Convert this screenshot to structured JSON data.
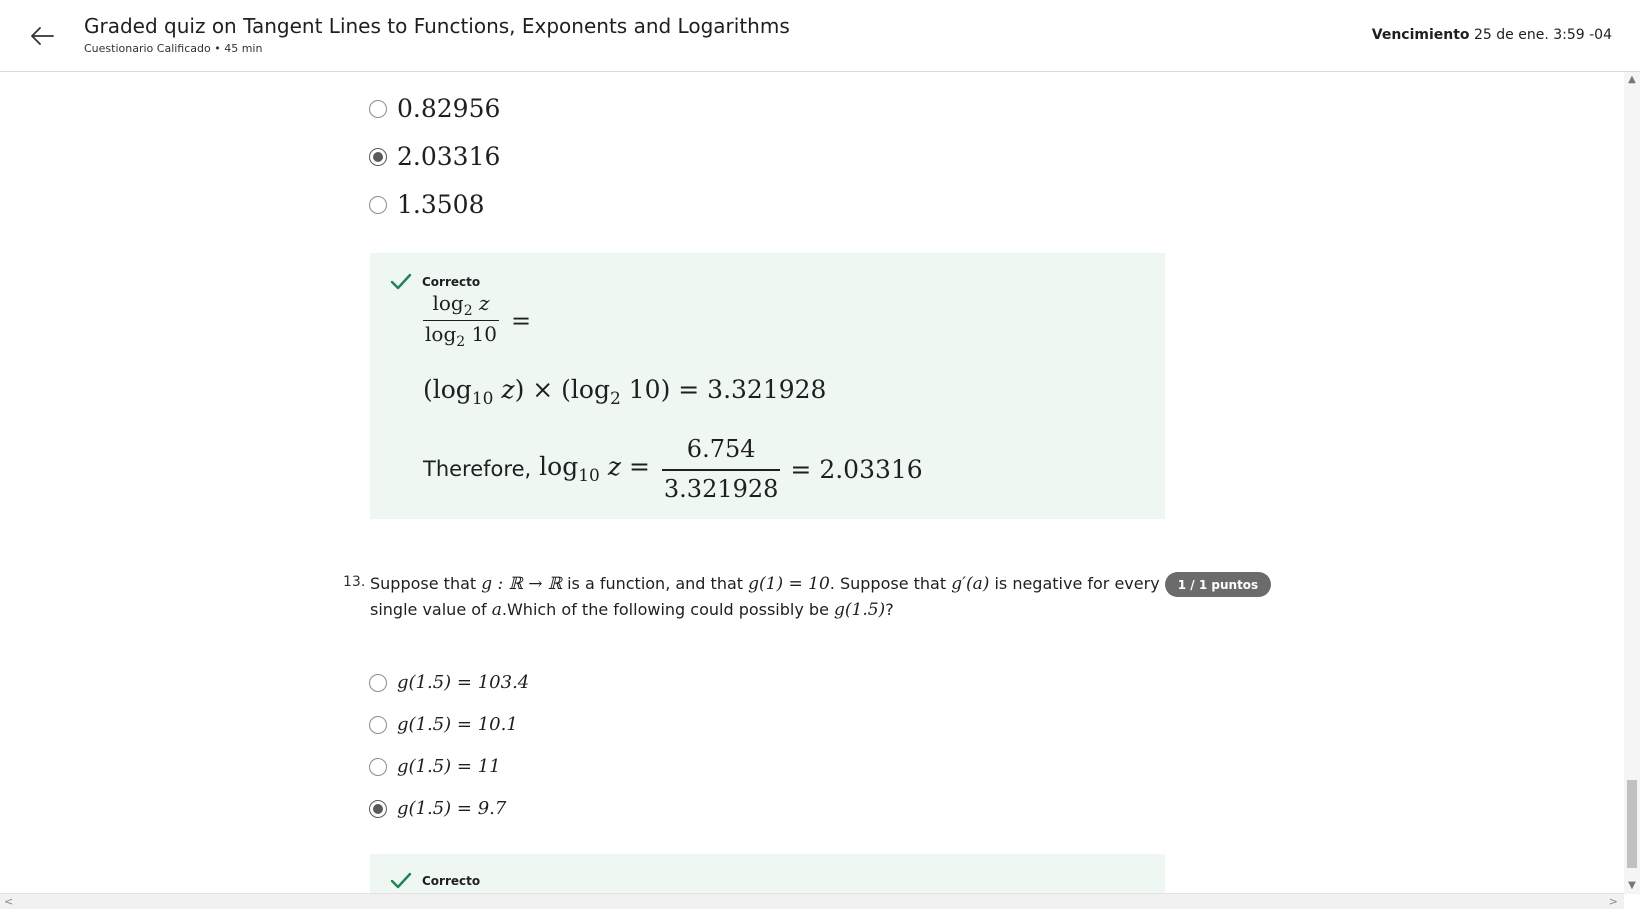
{
  "header": {
    "title": "Graded quiz on Tangent Lines to Functions, Exponents and Logarithms",
    "subtitle": "Cuestionario Calificado • 45 min",
    "due_label": "Vencimiento",
    "due_value": "25 de ene. 3:59 -04"
  },
  "q12": {
    "options": [
      {
        "label": "0.82956",
        "selected": false
      },
      {
        "label": "2.03316",
        "selected": true
      },
      {
        "label": "1.3508",
        "selected": false
      }
    ],
    "feedback": {
      "status": "Correcto",
      "line1_num_log": "log",
      "line1_num_sub": "2",
      "line1_num_var": "z",
      "line1_den_log": "log",
      "line1_den_sub": "2",
      "line1_den_val": "10",
      "line1_eq": "=",
      "line2": {
        "open": "(log",
        "sub1": "10",
        "var": "z",
        "mid": ") × (log",
        "sub2": "2",
        "val": "10) = 3.321928"
      },
      "line3": {
        "prefix": "Therefore,",
        "log": "log",
        "sub": "10",
        "var": "z",
        "eq": "=",
        "num": "6.754",
        "den": "3.321928",
        "result": "= 2.03316"
      }
    }
  },
  "q13": {
    "number": "13.",
    "text_parts": {
      "p1": "Suppose that ",
      "m1": "g : ℝ → ℝ",
      "p2": " is a function, and that ",
      "m2": "g(1) = 10",
      "p3": ". Suppose that ",
      "m3": "g′(a)",
      "p4": " is negative for every single value of ",
      "m4": "a",
      "p5": ".Which of the following could possibly be ",
      "m5": "g(1.5)",
      "p6": "?"
    },
    "points": "1 / 1 puntos",
    "options": [
      {
        "label": "g(1.5) = 103.4",
        "selected": false
      },
      {
        "label": "g(1.5) = 10.1",
        "selected": false
      },
      {
        "label": "g(1.5) = 11",
        "selected": false
      },
      {
        "label": "g(1.5) = 9.7",
        "selected": true
      }
    ],
    "feedback_status": "Correcto"
  },
  "colors": {
    "feedback_bg": "#eef7f2",
    "check_green": "#1f8354",
    "badge_bg": "#6b6b6b"
  },
  "icons": {
    "back": "arrow-left-icon",
    "correct": "checkmark-icon",
    "radio": "radio-icon"
  }
}
